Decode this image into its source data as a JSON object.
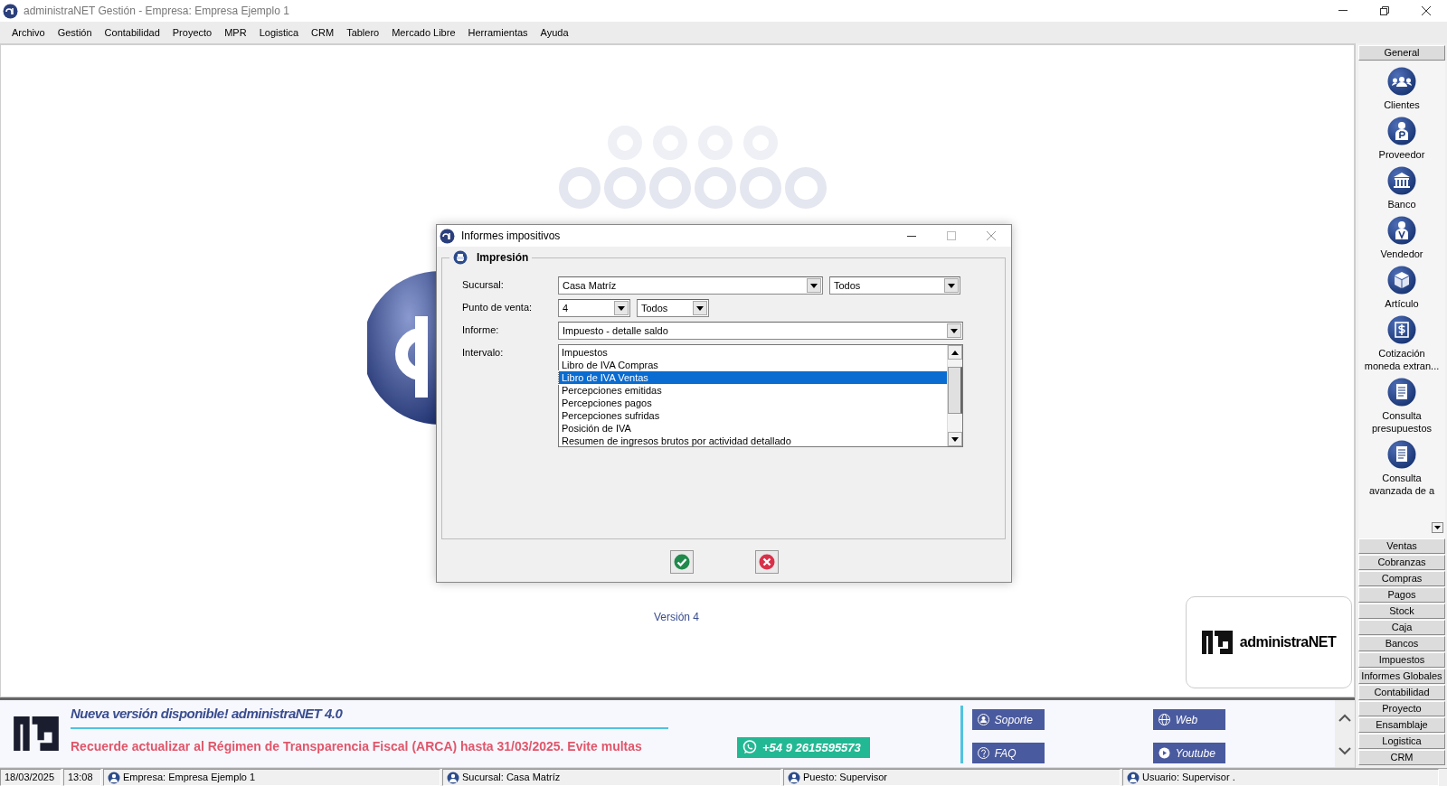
{
  "window": {
    "title": "administraNET Gestión - Empresa: Empresa Ejemplo 1"
  },
  "menu": [
    "Archivo",
    "Gestión",
    "Contabilidad",
    "Proyecto",
    "MPR",
    "Logistica",
    "CRM",
    "Tablero",
    "Mercado Libre",
    "Herramientas",
    "Ayuda"
  ],
  "background": {
    "version": "Versión 4"
  },
  "brand_box": {
    "name": "administraNET"
  },
  "dialog": {
    "title": "Informes impositivos",
    "section": "Impresión",
    "fields": [
      {
        "label": "Sucursal:",
        "kind": "combos",
        "combos": [
          {
            "value": "Casa Matríz",
            "kind": "wide"
          },
          {
            "value": "Todos",
            "kind": "medium"
          }
        ]
      },
      {
        "label": "Punto de venta:",
        "kind": "combos",
        "combos": [
          {
            "value": "4",
            "kind": "short"
          },
          {
            "value": "Todos",
            "kind": "short"
          }
        ]
      },
      {
        "label": "Informe:",
        "kind": "combos",
        "combos": [
          {
            "value": "Impuesto - detalle saldo",
            "kind": "full"
          }
        ]
      },
      {
        "label": "Intervalo:",
        "kind": "list",
        "items": [
          {
            "label": "Impuestos",
            "selected": false
          },
          {
            "label": "Libro de IVA Compras",
            "selected": false
          },
          {
            "label": "Libro de IVA Ventas",
            "selected": true
          },
          {
            "label": "Percepciones emitidas",
            "selected": false
          },
          {
            "label": "Percepciones pagos",
            "selected": false
          },
          {
            "label": "Percepciones sufridas",
            "selected": false
          },
          {
            "label": "Posición de IVA",
            "selected": false
          },
          {
            "label": "Resumen de ingresos brutos por actividad detallado",
            "selected": false
          }
        ]
      }
    ],
    "buttons": [
      {
        "kind": "ok"
      },
      {
        "kind": "cancel"
      }
    ]
  },
  "sidebar": {
    "groups": [
      {
        "label": "General",
        "items": [
          {
            "label": "Clientes",
            "kind": "people"
          },
          {
            "label": "Proveedor",
            "kind": "person-p"
          },
          {
            "label": "Banco",
            "kind": "bank"
          },
          {
            "label": "Vendedor",
            "kind": "person-v"
          },
          {
            "label": "Artículo",
            "kind": "box"
          },
          {
            "label": "Cotización moneda extran...",
            "kind": "dollar"
          },
          {
            "label": "Consulta presupuestos",
            "kind": "document"
          },
          {
            "label": "Consulta avanzada de a",
            "kind": "document"
          }
        ]
      },
      {
        "label": "Ventas"
      },
      {
        "label": "Cobranzas"
      },
      {
        "label": "Compras"
      },
      {
        "label": "Pagos"
      },
      {
        "label": "Stock"
      },
      {
        "label": "Caja"
      },
      {
        "label": "Bancos"
      },
      {
        "label": "Impuestos"
      },
      {
        "label": "Informes Globales"
      },
      {
        "label": "Contabilidad"
      },
      {
        "label": "Proyecto"
      },
      {
        "label": "Ensamblaje"
      },
      {
        "label": "Logistica"
      },
      {
        "label": "CRM"
      }
    ]
  },
  "banner": {
    "headline": "Nueva versión disponible! administraNET 4.0",
    "notice": "Recuerde actualizar al Régimen de Transparencia Fiscal (ARCA) hasta 31/03/2025. Evite multas",
    "whatsapp": "+54 9 2615595573",
    "links": [
      {
        "label": "Soporte",
        "kind": "support"
      },
      {
        "label": "Web",
        "kind": "web"
      },
      {
        "label": "FAQ",
        "kind": "faq"
      },
      {
        "label": "Youtube",
        "kind": "youtube"
      }
    ]
  },
  "status_bar": [
    {
      "text": "18/03/2025",
      "kind": "text"
    },
    {
      "text": "13:08",
      "kind": "text"
    },
    {
      "text": "Empresa: Empresa Ejemplo 1",
      "kind": "user"
    },
    {
      "text": "Sucursal: Casa Matríz",
      "kind": "user"
    },
    {
      "text": "Puesto: Supervisor",
      "kind": "user"
    },
    {
      "text": "Usuario: Supervisor .",
      "kind": "user"
    }
  ]
}
